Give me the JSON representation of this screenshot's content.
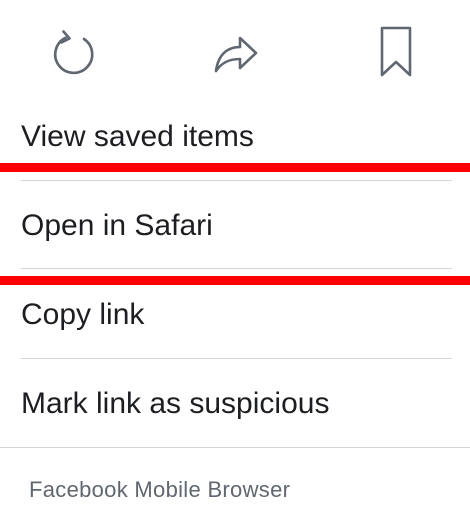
{
  "actions": {
    "refresh_icon": "refresh-icon",
    "share_icon": "share-icon",
    "bookmark_icon": "bookmark-icon"
  },
  "menu": {
    "items": [
      {
        "label": "View saved items"
      },
      {
        "label": "Open in Safari"
      },
      {
        "label": "Copy link"
      },
      {
        "label": "Mark link as suspicious"
      }
    ]
  },
  "footer": {
    "text": "Facebook Mobile Browser"
  },
  "colors": {
    "icon_gray": "#606770",
    "text": "#1c1e21",
    "divider": "#d6d6d6",
    "highlight": "#ff0000"
  }
}
